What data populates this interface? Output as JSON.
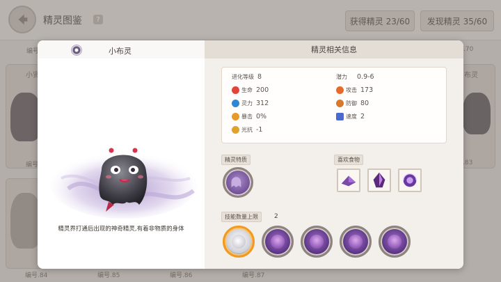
{
  "header": {
    "title": "精灵图鉴",
    "help": "?",
    "obtained_label": "获得精灵 23/60",
    "discovered_label": "发现精灵 35/60"
  },
  "background_cards": {
    "numbers_top": [
      "编号",
      ".70"
    ],
    "number_left_mid": "编号",
    "numbers_bottom": [
      "编号.84",
      "编号.85",
      "编号.86",
      "编号.87"
    ],
    "right_mid_number": ".83",
    "left_peek_text": "小贤",
    "right_peek_text": "布灵"
  },
  "modal": {
    "left": {
      "name": "小布灵",
      "description": "精灵界打通后出现的神奇精灵,有着非物质的身体"
    },
    "right": {
      "title": "精灵相关信息",
      "evolution": {
        "label": "进化等级",
        "value": "8"
      },
      "potential": {
        "label": "潜力",
        "value": "0.9-6"
      },
      "stats": [
        {
          "label": "生命",
          "value": "200",
          "icon": "hp-icon",
          "color": "#e0443b"
        },
        {
          "label": "攻击",
          "value": "173",
          "icon": "attack-icon",
          "color": "#e56a2b"
        },
        {
          "label": "灵力",
          "value": "312",
          "icon": "spirit-icon",
          "color": "#2e86d6"
        },
        {
          "label": "防御",
          "value": "80",
          "icon": "defense-icon",
          "color": "#d9772a"
        },
        {
          "label": "暴击",
          "value": "0%",
          "icon": "crit-icon",
          "color": "#e59a2a"
        },
        {
          "label": "速度",
          "value": "2",
          "icon": "speed-icon",
          "color": "#4a6ad0"
        },
        {
          "label": "光抗",
          "value": "-1",
          "icon": "light-resist-icon",
          "color": "#e0a22a"
        }
      ],
      "trait_label": "精灵特质",
      "food_label": "喜欢食物",
      "skill_count_label": "技能数量上限",
      "skill_count": "2"
    }
  }
}
